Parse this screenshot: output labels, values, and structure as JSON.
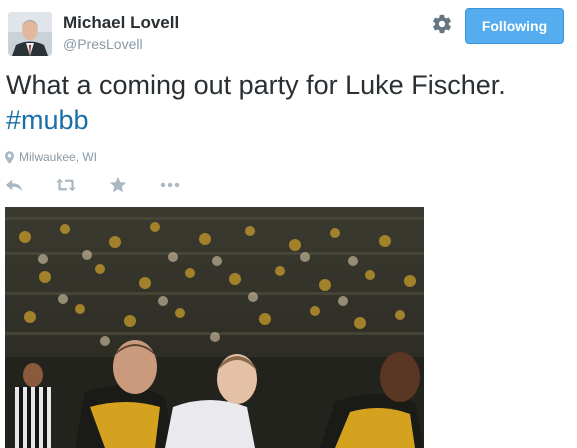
{
  "user": {
    "name": "Michael Lovell",
    "handle": "@PresLovell"
  },
  "follow_button": {
    "label": "Following"
  },
  "tweet": {
    "text": "What a coming out party for Luke Fischer.",
    "hashtag": "#mubb",
    "location": "Milwaukee, WI"
  },
  "actions": [
    "reply-icon",
    "retweet-icon",
    "favorite-icon",
    "more-icon"
  ],
  "colors": {
    "follow_button": "#55acee",
    "hashtag": "#1b6fa8",
    "muted": "#8899a6",
    "icon": "#aab8c2"
  }
}
